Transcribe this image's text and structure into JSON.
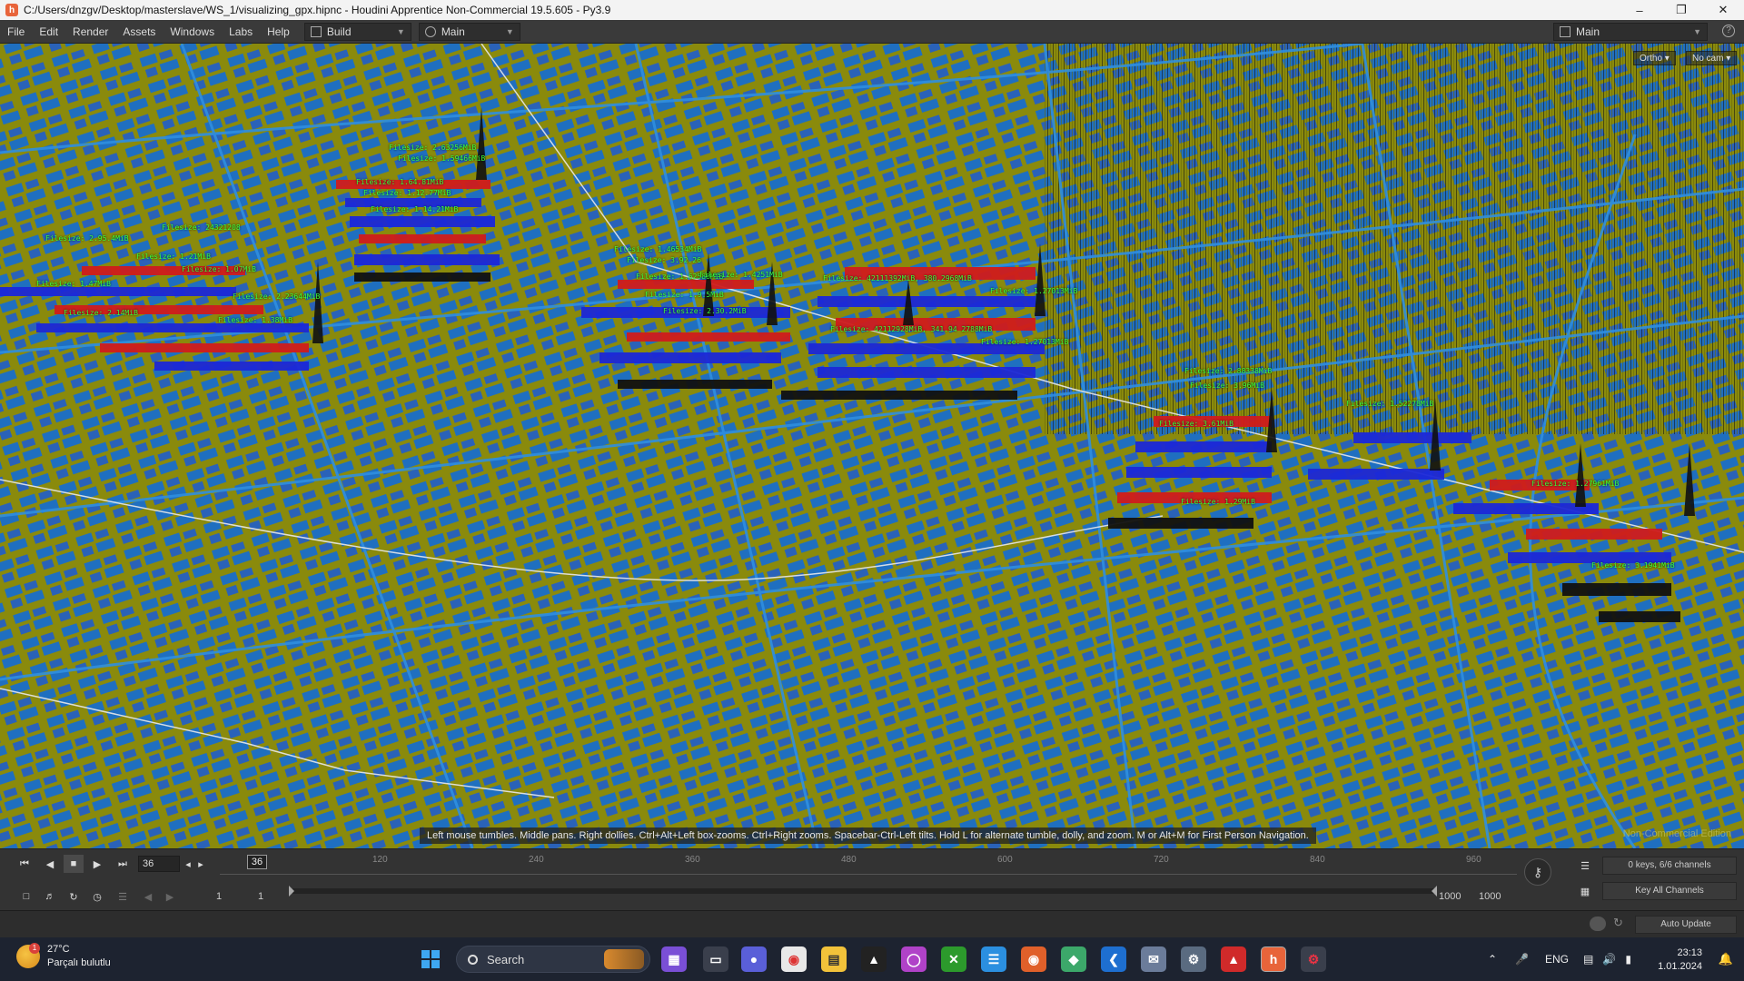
{
  "window": {
    "title": "C:/Users/dnzgv/Desktop/masterslave/WS_1/visualizing_gpx.hipnc - Houdini Apprentice Non-Commercial 19.5.605 - Py3.9",
    "minimize_icon": "minimize-icon",
    "maximize_icon": "restore-icon",
    "close_icon": "close-icon"
  },
  "menu": {
    "items": [
      "File",
      "Edit",
      "Render",
      "Assets",
      "Windows",
      "Labs",
      "Help"
    ],
    "build_desk": "Build",
    "main_desk": "Main",
    "right_desk": "Main"
  },
  "viewport": {
    "ortho_label": "Ortho",
    "camera_label": "No cam",
    "hint": "Left mouse tumbles. Middle pans. Right dollies. Ctrl+Alt+Left box-zooms. Ctrl+Right zooms. Spacebar-Ctrl-Left tilts. Hold L for alternate tumble, dolly, and zoom.    M or Alt+M for First Person Navigation.",
    "watermark": "Non-Commercial Edition",
    "colors": {
      "ground": "#8a8a0c",
      "streets": "#1e78c8",
      "bars_red": "#d01c1c",
      "bars_blue": "#1c28d8",
      "labels": "#3cff3c"
    },
    "labels": [
      "Filesize: 2.63256MiB",
      "Filesize: 1.59466MiB",
      "Filesize: 1.64.81MiB",
      "Filesize: 1.12.77MiB",
      "Filesize: 1.14.21MiB",
      "Filesize: 24321208",
      "Filesize: 2.95.4MiB",
      "Filesize: 1.21MiB",
      "Filesize: 1.07MiB",
      "Filesize: 1.47MiB",
      "Filesize: 2.23644MiB",
      "Filesize: 2.14MiB",
      "Filesize: 1.38MiB",
      "Filesize: 1.46534MiB",
      "Filesize: 3.92.26",
      "Filesize: 1.62588MiB",
      "Filesize: 1.4251MiB",
      "Filesize: 1.9.5MiB",
      "Filesize: 2.30.2MiB",
      "Filesize: 42111392MiB, 380.2968MiB",
      "Filesize: 1.27013MiB",
      "Filesize: 42112928MiB, 341.94 2788MiB",
      "Filesize: 1.27013MiB",
      "Filesize: 2.88338MiB",
      "Filesize: 1.52278MiB",
      "Filesize: 3.96MiB",
      "Filesize: 3.61MiB",
      "Filesize: 1.27961MiB",
      "Filesize: 3.1941MiB",
      "Filesize: 1.29MiB"
    ]
  },
  "timeline": {
    "current_frame": "36",
    "playhead_frame": "36",
    "ticks": [
      "120",
      "240",
      "360",
      "480",
      "600",
      "720",
      "840",
      "960"
    ],
    "range_start": "1",
    "range_start2": "1",
    "range_end": "1000",
    "range_end2": "1000",
    "keys_info": "0 keys, 6/6 channels",
    "key_all": "Key All Channels",
    "auto_update": "Auto Update"
  },
  "taskbar": {
    "weather_temp": "27°C",
    "weather_desc": "Parçalı bulutlu",
    "weather_badge": "1",
    "search": "Search",
    "language": "ENG",
    "time": "23:13",
    "date": "1.01.2024"
  }
}
